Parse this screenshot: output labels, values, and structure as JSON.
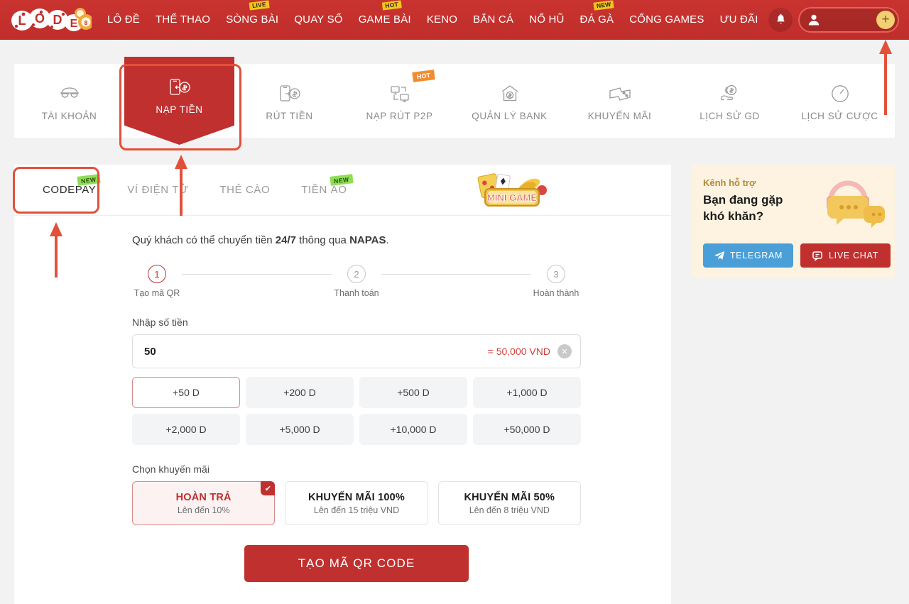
{
  "brand": {
    "logo_text": "LODE",
    "accent": "#c0302f",
    "gold": "#f2cf72"
  },
  "topnav": {
    "items": [
      {
        "label": "LÔ ĐỀ",
        "badge": ""
      },
      {
        "label": "THỂ THAO",
        "badge": ""
      },
      {
        "label": "SÒNG BÀI",
        "badge": "LIVE"
      },
      {
        "label": "QUAY SỐ",
        "badge": ""
      },
      {
        "label": "GAME BÀI",
        "badge": "HOT"
      },
      {
        "label": "KENO",
        "badge": ""
      },
      {
        "label": "BẮN CÁ",
        "badge": ""
      },
      {
        "label": "NỔ HŨ",
        "badge": ""
      },
      {
        "label": "ĐÁ GÀ",
        "badge": "NEW"
      },
      {
        "label": "CỔNG GAMES",
        "badge": ""
      },
      {
        "label": "ƯU ĐÃI",
        "badge": ""
      }
    ],
    "bell_icon": "bell-icon",
    "user_icon": "user-avatar-icon",
    "deposit_plus": "+"
  },
  "function_tabs": [
    {
      "label": "TÀI KHOẢN",
      "icon": "mask-glasses-icon",
      "badge": "",
      "active": false
    },
    {
      "label": "NẠP TIỀN",
      "icon": "phone-deposit-icon",
      "badge": "",
      "active": true
    },
    {
      "label": "RÚT TIỀN",
      "icon": "phone-withdraw-icon",
      "badge": "",
      "active": false
    },
    {
      "label": "NẠP RÚT P2P",
      "icon": "p2p-transfer-icon",
      "badge": "HOT",
      "active": false
    },
    {
      "label": "QUẢN LÝ BANK",
      "icon": "bank-house-icon",
      "badge": "",
      "active": false
    },
    {
      "label": "KHUYẾN MÃI",
      "icon": "ticket-percent-icon",
      "badge": "",
      "active": false
    },
    {
      "label": "LỊCH SỬ GD",
      "icon": "hand-money-icon",
      "badge": "",
      "active": false
    },
    {
      "label": "LỊCH SỬ CƯỢC",
      "icon": "clock-icon",
      "badge": "",
      "active": false
    }
  ],
  "sub_tabs": [
    {
      "label": "CODEPAY",
      "badge": "NEW",
      "active": true
    },
    {
      "label": "VÍ ĐIỆN TỬ",
      "badge": "",
      "active": false
    },
    {
      "label": "THẺ CÀO",
      "badge": "",
      "active": false
    },
    {
      "label": "TIỀN ẢO",
      "badge": "NEW",
      "active": false
    }
  ],
  "minigame_banner": {
    "label": "MINI GAME"
  },
  "deposit": {
    "notice_prefix": "Quý khách có thể chuyển tiền ",
    "notice_bold1": "24/7",
    "notice_mid": " thông qua ",
    "notice_bold2": "NAPAS",
    "notice_suffix": ".",
    "notice_full": "Quý khách có thể chuyển tiền 24/7 thông qua NAPAS.",
    "steps": [
      {
        "num": "1",
        "label": "Tạo mã QR",
        "active": true
      },
      {
        "num": "2",
        "label": "Thanh toán",
        "active": false
      },
      {
        "num": "3",
        "label": "Hoàn thành",
        "active": false
      }
    ],
    "amount_label": "Nhập số tiền",
    "amount_value": "50",
    "amount_placeholder": "Nhập số tiền",
    "amount_conversion": "= 50,000 VND",
    "clear_icon": "clear-x-icon",
    "quick_amounts": [
      {
        "label": "+50 D",
        "selected": true
      },
      {
        "label": "+200 D",
        "selected": false
      },
      {
        "label": "+500 D",
        "selected": false
      },
      {
        "label": "+1,000 D",
        "selected": false
      },
      {
        "label": "+2,000 D",
        "selected": false
      },
      {
        "label": "+5,000 D",
        "selected": false
      },
      {
        "label": "+10,000 D",
        "selected": false
      },
      {
        "label": "+50,000 D",
        "selected": false
      }
    ],
    "promo_label": "Chọn khuyến mãi",
    "promos": [
      {
        "title": "HOÀN TRẢ",
        "sub": "Lên đến 10%",
        "selected": true,
        "check_icon": "checkmark-icon"
      },
      {
        "title": "KHUYẾN MÃI 100%",
        "sub": "Lên đến 15 triệu VND",
        "selected": false
      },
      {
        "title": "KHUYẾN MÃI 50%",
        "sub": "Lên đến 8 triệu VND",
        "selected": false
      }
    ],
    "submit_label": "TẠO MÃ QR CODE"
  },
  "support": {
    "kicker": "Kênh hỗ trợ",
    "title_line1": "Bạn đang gặp",
    "title_line2": "khó khăn?",
    "art_icon": "headset-chat-icon",
    "buttons": [
      {
        "label": "TELEGRAM",
        "icon": "telegram-icon",
        "color": "#4a9fd8"
      },
      {
        "label": "LIVE CHAT",
        "icon": "livechat-icon",
        "color": "#c0302f"
      }
    ]
  },
  "annotations": {
    "color": "#e2503a",
    "boxes": [
      {
        "name": "nap-tien-highlight"
      },
      {
        "name": "codepay-highlight"
      }
    ],
    "arrows": [
      {
        "name": "arrow-to-deposit-plus"
      },
      {
        "name": "arrow-to-nap-tien"
      },
      {
        "name": "arrow-to-codepay"
      }
    ]
  }
}
